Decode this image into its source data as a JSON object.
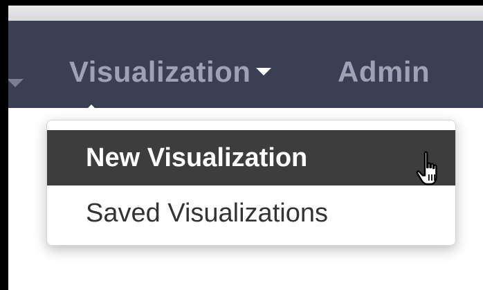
{
  "navbar": {
    "items": [
      {
        "label": "Visualization"
      },
      {
        "label": "Admin"
      }
    ],
    "icons": {
      "left_caret": "caret-down-icon",
      "visualization_caret": "caret-down-icon"
    },
    "background_color": "#3b3f53"
  },
  "dropdown": {
    "items": [
      {
        "label": "New Visualization",
        "state": "hovered"
      },
      {
        "label": "Saved Visualizations",
        "state": "normal"
      }
    ],
    "active_background": "#3d3d3d"
  },
  "cursor": {
    "icon": "hand-pointer-icon"
  }
}
